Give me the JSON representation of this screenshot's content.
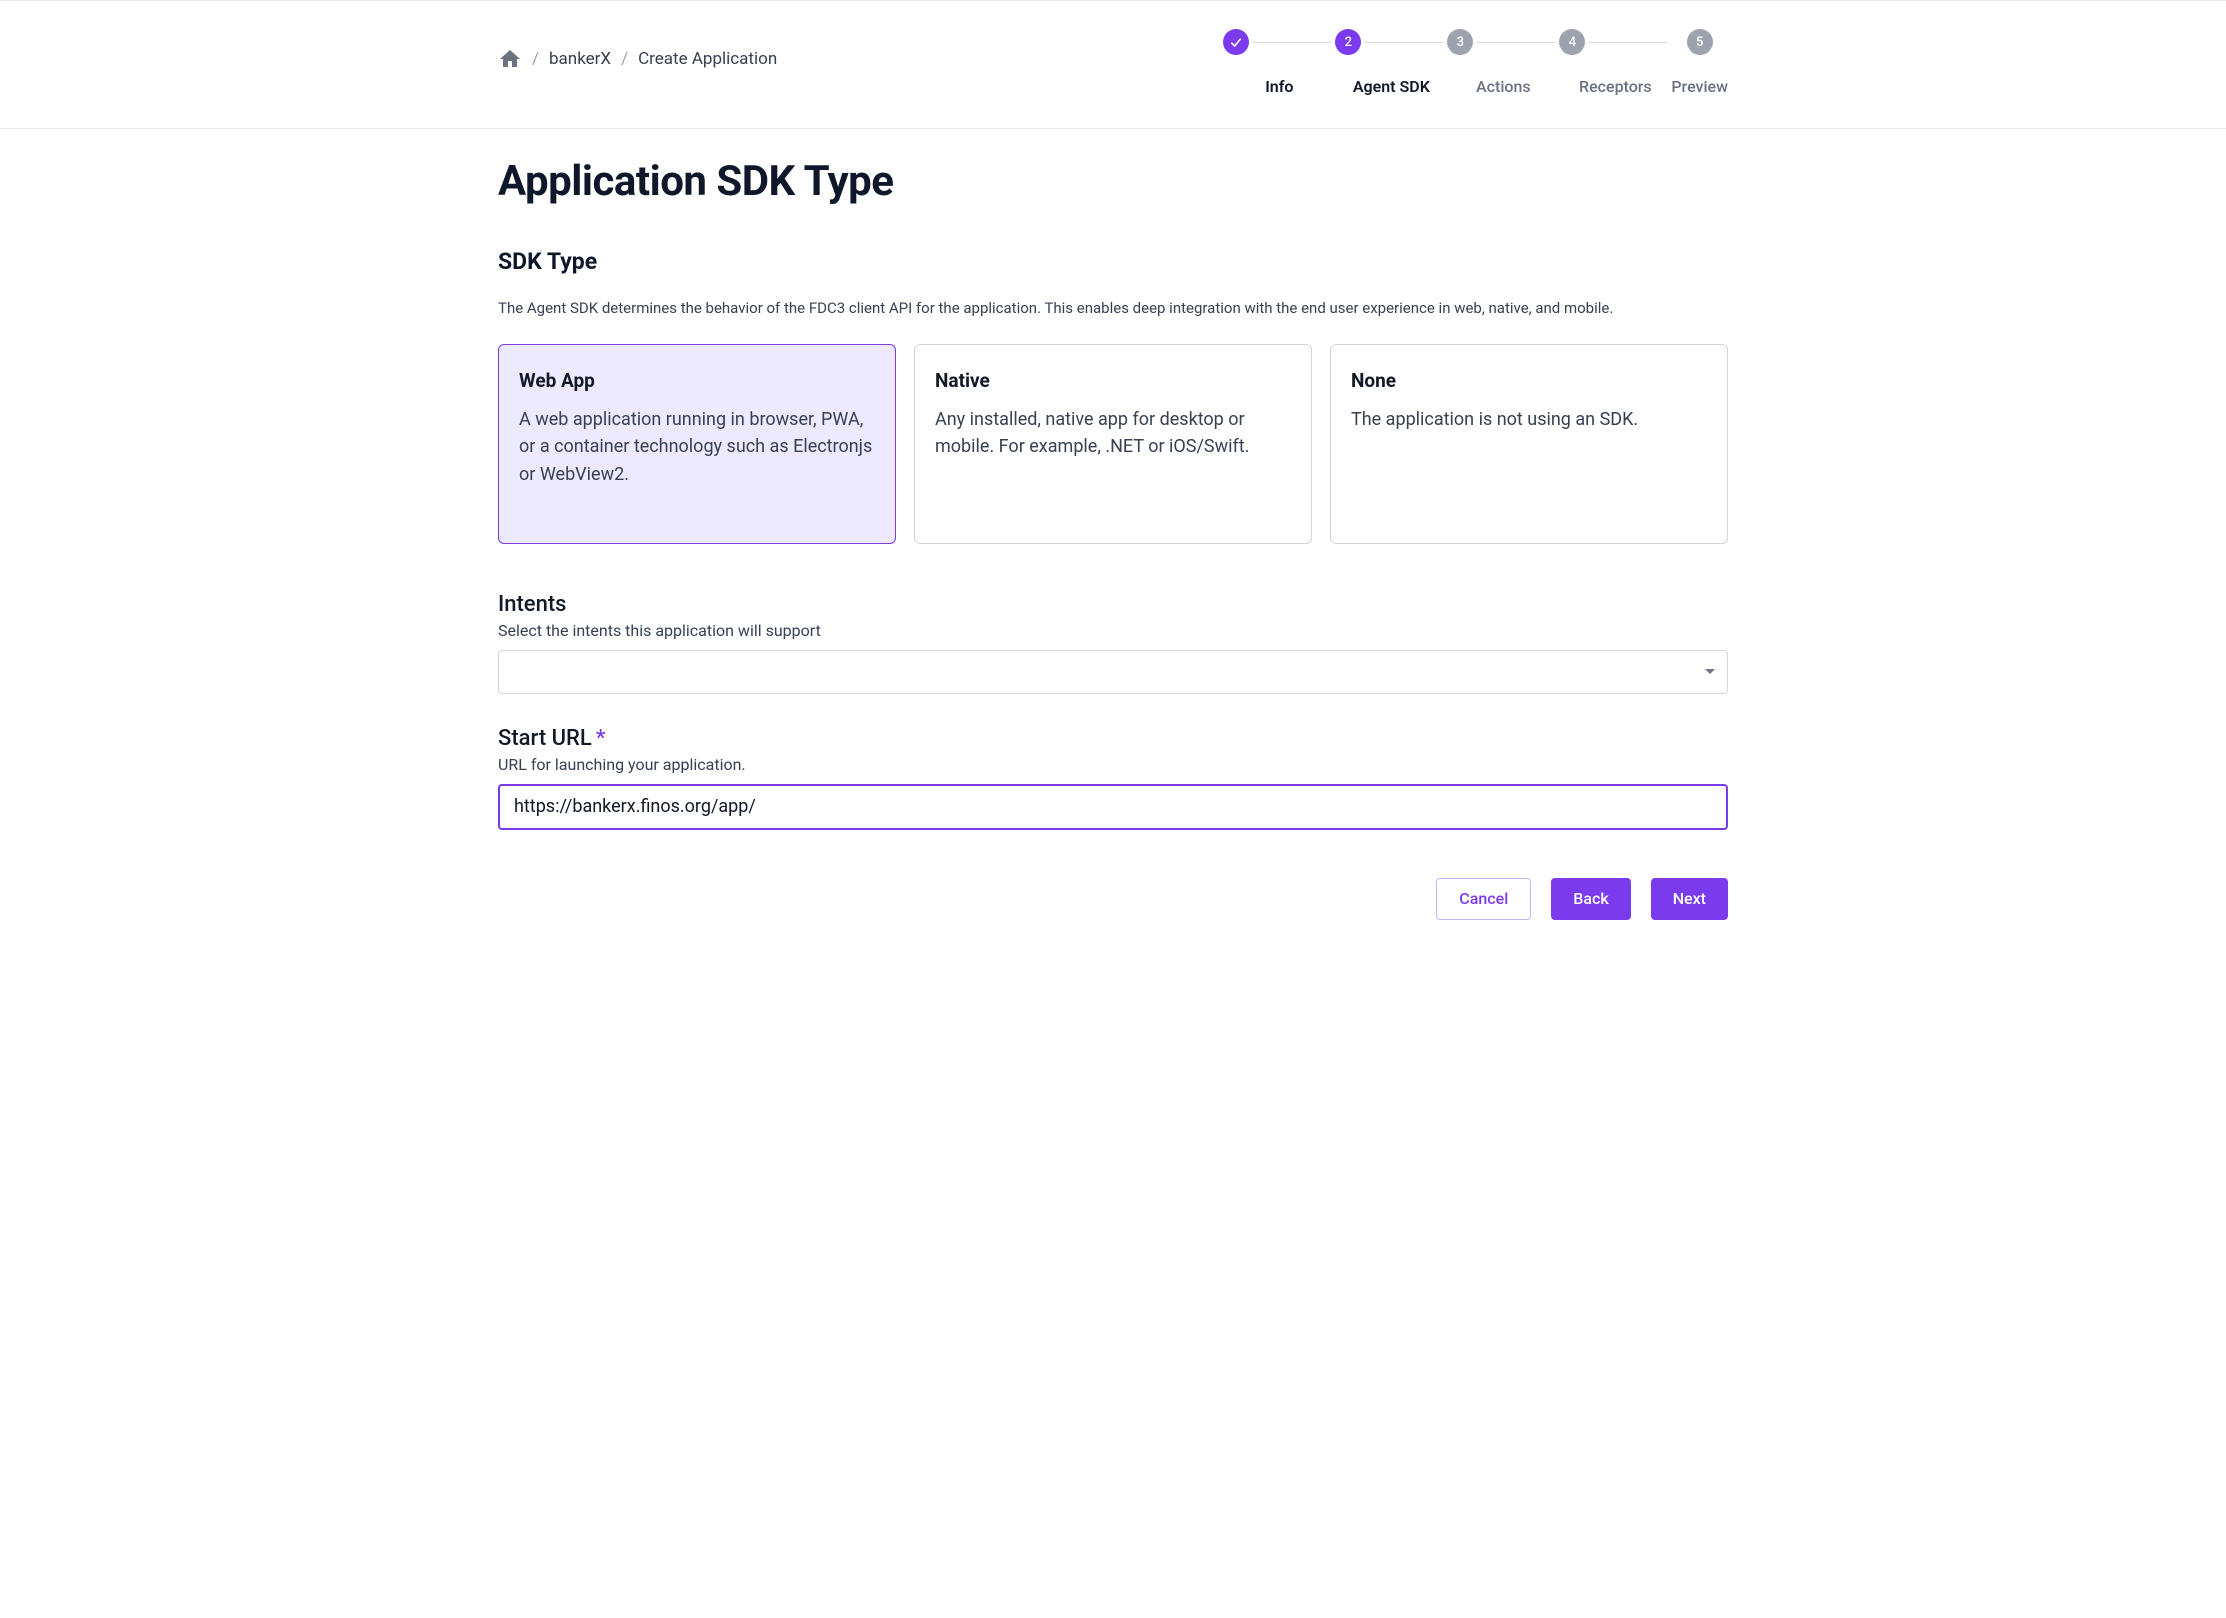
{
  "breadcrumb": {
    "items": [
      "bankerX",
      "Create Application"
    ]
  },
  "stepper": {
    "steps": [
      {
        "label": "Info",
        "state": "done"
      },
      {
        "label": "Agent SDK",
        "state": "active",
        "num": "2"
      },
      {
        "label": "Actions",
        "state": "pending",
        "num": "3"
      },
      {
        "label": "Receptors",
        "state": "pending",
        "num": "4"
      },
      {
        "label": "Preview",
        "state": "pending",
        "num": "5"
      }
    ]
  },
  "page": {
    "title": "Application SDK Type"
  },
  "sdk_section": {
    "title": "SDK Type",
    "description": "The Agent SDK determines the behavior of the FDC3 client API for the application. This enables deep integration with the end user experience in web, native, and mobile.",
    "cards": [
      {
        "title": "Web App",
        "body": "A web application running in browser, PWA, or a container technology such as Electronjs or WebView2.",
        "selected": true
      },
      {
        "title": "Native",
        "body": "Any installed, native app for desktop or mobile. For example, .NET or iOS/Swift.",
        "selected": false
      },
      {
        "title": "None",
        "body": "The application is not using an SDK.",
        "selected": false
      }
    ]
  },
  "intents": {
    "title": "Intents",
    "sub": "Select the intents this application will support",
    "value": ""
  },
  "start_url": {
    "title": "Start URL",
    "sub": "URL for launching your application.",
    "value": "https://bankerx.finos.org/app/"
  },
  "buttons": {
    "cancel": "Cancel",
    "back": "Back",
    "next": "Next"
  }
}
